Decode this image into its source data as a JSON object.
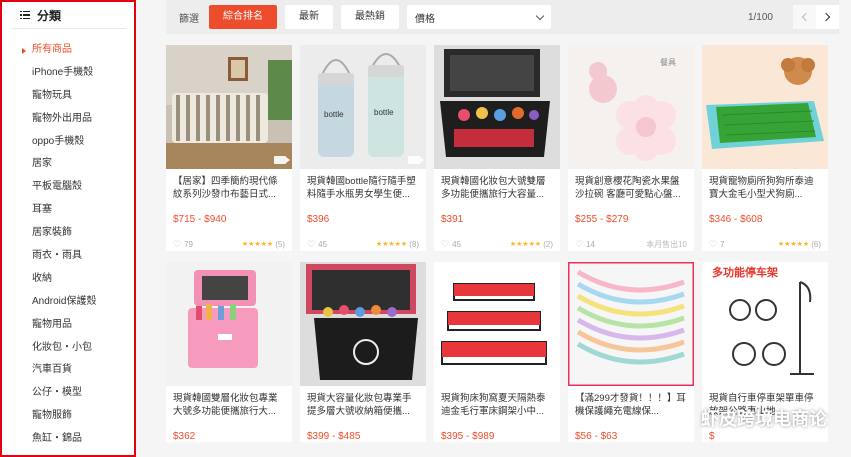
{
  "sidebar": {
    "header": "分類",
    "categories": [
      {
        "label": "所有商品",
        "active": true
      },
      {
        "label": "iPhone手機殼"
      },
      {
        "label": "寵物玩具"
      },
      {
        "label": "寵物外出用品"
      },
      {
        "label": "oppo手機殼"
      },
      {
        "label": "居家"
      },
      {
        "label": "平板電腦殼"
      },
      {
        "label": "耳塞"
      },
      {
        "label": "居家裝飾"
      },
      {
        "label": "雨衣・雨具"
      },
      {
        "label": "收納"
      },
      {
        "label": "Android保護殼"
      },
      {
        "label": "寵物用品"
      },
      {
        "label": "化妝包・小包"
      },
      {
        "label": "汽車百貨"
      },
      {
        "label": "公仔・模型"
      },
      {
        "label": "寵物服飾"
      },
      {
        "label": "魚缸・錦品"
      }
    ]
  },
  "sortbar": {
    "label": "篩選",
    "buttons": [
      {
        "label": "綜合排名",
        "active": true
      },
      {
        "label": "最新"
      },
      {
        "label": "最熱銷"
      }
    ],
    "price_label": "價格",
    "page_indicator": "1/100"
  },
  "products": [
    {
      "title": "【居家】四季簡約現代條紋系列沙發巾布藝日式...",
      "price": "$715 - $940",
      "likes": "79",
      "rating_count": "(5)",
      "stars": "★★★★★",
      "sold": "",
      "has_video": true
    },
    {
      "title": "現貨韓國bottle隨行隨手塑料隨手水瓶男女學生便...",
      "price": "$396",
      "likes": "45",
      "rating_count": "(8)",
      "stars": "★★★★★",
      "sold": "",
      "has_video": true
    },
    {
      "title": "現貨韓國化妝包大號雙層多功能便攜旅行大容量...",
      "price": "$391",
      "likes": "45",
      "rating_count": "(2)",
      "stars": "★★★★★",
      "sold": "",
      "has_video": false
    },
    {
      "title": "現貨創意櫻花陶瓷水果盤沙拉碗 客廳可愛點心盤...",
      "price": "$255 - $279",
      "likes": "14",
      "rating_count": "",
      "stars": "",
      "sold": "本月售出10",
      "has_video": false
    },
    {
      "title": "現貨寵物廁所狗狗所泰迪寶大金毛小型犬狗廁...",
      "price": "$346 - $608",
      "likes": "7",
      "rating_count": "(6)",
      "stars": "★★★★★",
      "sold": "",
      "has_video": false
    },
    {
      "title": "現貨韓國雙層化妝包專業大號多功能便攜旅行大...",
      "price": "$362",
      "likes": "",
      "rating_count": "",
      "stars": "",
      "sold": "",
      "has_video": false
    },
    {
      "title": "現貨大容量化妝包專業手提多層大號收納箱便攜...",
      "price": "$399 - $485",
      "likes": "",
      "rating_count": "",
      "stars": "",
      "sold": "",
      "has_video": false
    },
    {
      "title": "現貨狗床狗窩夏天隔熱泰迪金毛行軍床鋼架小中...",
      "price": "$395 - $989",
      "likes": "",
      "rating_count": "",
      "stars": "",
      "sold": "",
      "has_video": false
    },
    {
      "title": "【滿299才發貨！！！】耳機保護繩充電線保...",
      "price": "$56 - $63",
      "likes": "",
      "rating_count": "",
      "stars": "",
      "sold": "",
      "has_video": false
    },
    {
      "title": "現貨自行車停車架單車停放架公路車山地...",
      "price": "$",
      "likes": "",
      "rating_count": "",
      "stars": "",
      "sold": "",
      "has_video": false
    }
  ],
  "thumb_texts": {
    "bottle1": "bottle",
    "bottle2": "bottle",
    "plate": "餐具",
    "bike_banner": "多功能停车架"
  },
  "watermark": "虾皮跨境电商论",
  "icons": [
    "list-icon",
    "heart-icon",
    "star-icon",
    "video-icon",
    "chevron-down-icon",
    "chevron-left-icon",
    "chevron-right-icon",
    "wechat-icon"
  ],
  "colors": {
    "accent": "#ee4d2d",
    "highlight_border": "#e60012",
    "star": "#fcb626"
  }
}
